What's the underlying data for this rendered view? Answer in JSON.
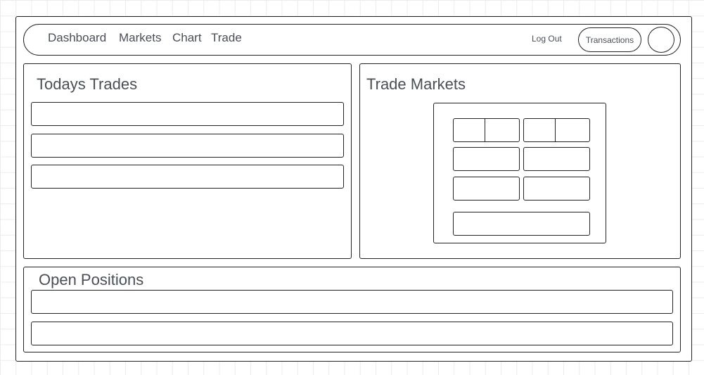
{
  "nav": {
    "links": [
      "Dashboard",
      "Markets",
      "Chart",
      "Trade"
    ],
    "logout_label": "Log Out",
    "transactions_label": "Transactions"
  },
  "todays_trades": {
    "title": "Todays Trades",
    "row_count": 3
  },
  "trade_markets": {
    "title": "Trade Markets"
  },
  "open_positions": {
    "title": "Open Positions",
    "row_count": 2
  }
}
